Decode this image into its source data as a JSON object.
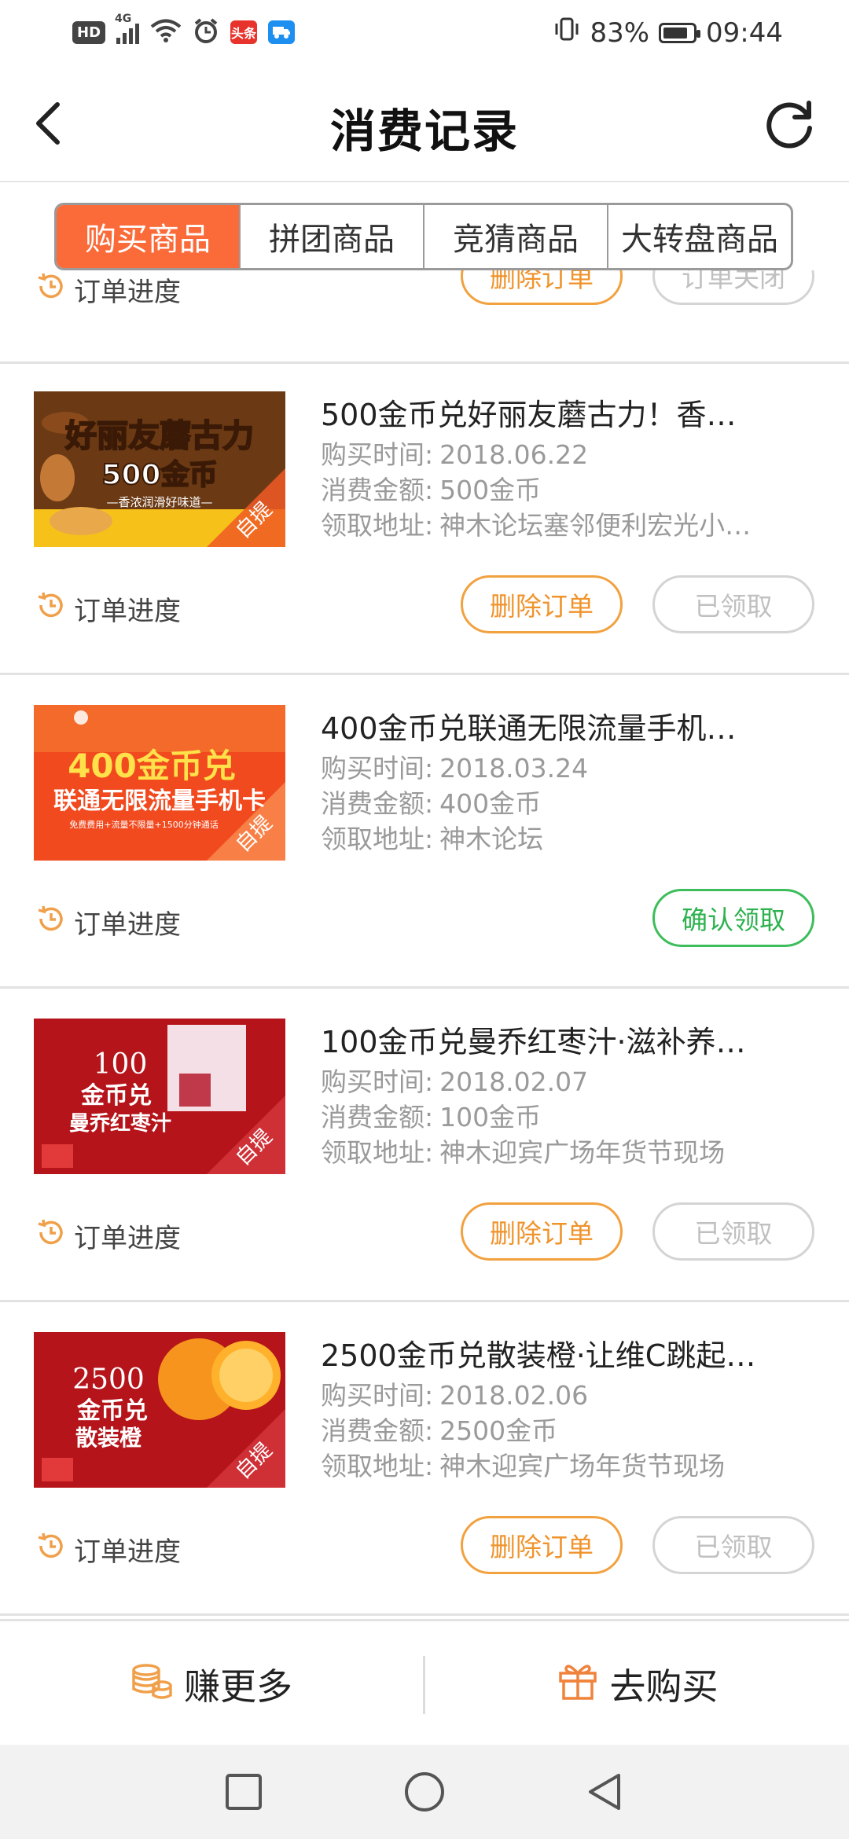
{
  "status_bar": {
    "hd": "HD",
    "signal_type": "4G",
    "app_badge_1": "头条",
    "battery_percent": "83%",
    "battery_level": 0.83,
    "time": "09:44"
  },
  "header": {
    "title": "消费记录"
  },
  "tabs": [
    {
      "label": "购买商品",
      "active": true
    },
    {
      "label": "拼团商品",
      "active": false
    },
    {
      "label": "竞猜商品",
      "active": false
    },
    {
      "label": "大转盘商品",
      "active": false
    }
  ],
  "labels": {
    "progress": "订单进度",
    "buy_time": "购买时间:",
    "amount": "消费金额:",
    "address": "领取地址:"
  },
  "partial_order": {
    "progress": "订单进度",
    "buttons": [
      {
        "label": "删除订单",
        "style": "del"
      },
      {
        "label": "订单关闭",
        "style": "grey"
      }
    ]
  },
  "orders": [
    {
      "title": "500金币兑好丽友蘑古力！香…",
      "buy_time": "2018.06.22",
      "amount": "500金币",
      "address": "神木论坛塞邻便利宏光小…",
      "thumb": {
        "line1": "好丽友蘑古力",
        "line2": "500金币",
        "line3": "—香浓润滑好味道—",
        "tag": "自提",
        "bg": "#f6c21a"
      },
      "buttons": [
        {
          "label": "删除订单",
          "style": "del"
        },
        {
          "label": "已领取",
          "style": "grey"
        }
      ]
    },
    {
      "title": "400金币兑联通无限流量手机…",
      "buy_time": "2018.03.24",
      "amount": "400金币",
      "address": "神木论坛",
      "thumb": {
        "line1": "400金币兑",
        "line2": "联通无限流量手机卡",
        "line3": "免费费用+流量不限量+1500分钟通话",
        "tag": "自提",
        "bg": "#f24a1f"
      },
      "buttons": [
        {
          "label": "确认领取",
          "style": "green"
        }
      ]
    },
    {
      "title": "100金币兑曼乔红枣汁·滋补养…",
      "buy_time": "2018.02.07",
      "amount": "100金币",
      "address": "神木迎宾广场年货节现场",
      "thumb": {
        "line1": "100",
        "line2": "金币兑",
        "line3": "曼乔红枣汁",
        "tag": "自提",
        "bg": "#b5141a"
      },
      "buttons": [
        {
          "label": "删除订单",
          "style": "del"
        },
        {
          "label": "已领取",
          "style": "grey"
        }
      ]
    },
    {
      "title": "2500金币兑散装橙·让维C跳起…",
      "buy_time": "2018.02.06",
      "amount": "2500金币",
      "address": "神木迎宾广场年货节现场",
      "thumb": {
        "line1": "2500",
        "line2": "金币兑",
        "line3": "散装橙",
        "tag": "自提",
        "bg": "#b5141a"
      },
      "buttons": [
        {
          "label": "删除订单",
          "style": "del"
        },
        {
          "label": "已领取",
          "style": "grey"
        }
      ]
    }
  ],
  "action_bar": {
    "earn_label": "赚更多",
    "buy_label": "去购买"
  },
  "colors": {
    "accent": "#fb6b3a",
    "orange": "#f0932b",
    "green": "#2db24e",
    "grey": "#c0c0c0"
  }
}
